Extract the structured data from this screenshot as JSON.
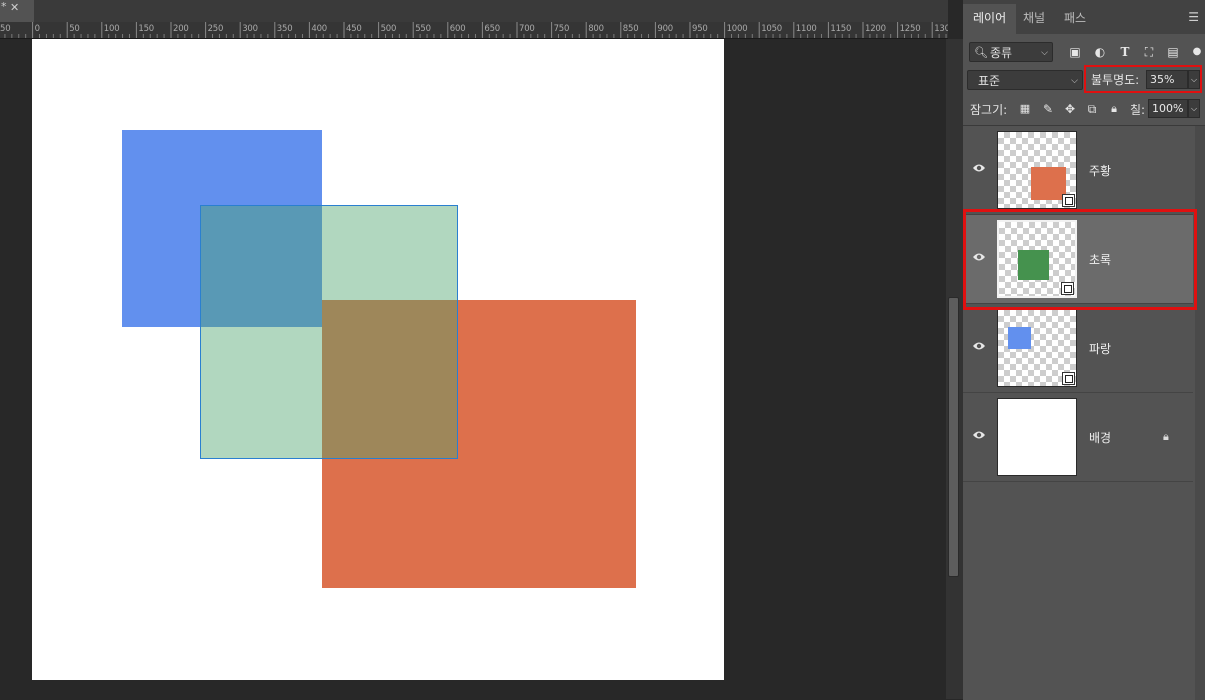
{
  "document": {
    "tab_marker": "*",
    "ruler_labels": [
      "50",
      "0",
      "50",
      "100",
      "150",
      "200",
      "250",
      "300",
      "350",
      "400",
      "450",
      "500",
      "550",
      "600",
      "650",
      "700",
      "750",
      "800",
      "850",
      "900",
      "950",
      "1000",
      "1050",
      "1100",
      "1150",
      "1200",
      "1250",
      "130"
    ]
  },
  "canvas": {
    "colors": {
      "blue": "#6290ee",
      "green": "#4ea56e",
      "orange": "#dd704c",
      "green_opacity_percent": 35
    }
  },
  "panel": {
    "tabs": [
      {
        "label": "레이어",
        "active": true
      },
      {
        "label": "채널",
        "active": false
      },
      {
        "label": "패스",
        "active": false
      }
    ],
    "filter": {
      "label": "종류",
      "icons": [
        "image-filter-icon",
        "adjustment-filter-icon",
        "type-filter-icon",
        "shape-filter-icon",
        "smart-object-filter-icon"
      ]
    },
    "blend_mode": "표준",
    "opacity": {
      "label": "불투명도:",
      "value": "35%"
    },
    "lock": {
      "label": "잠그기:",
      "icons": [
        "lock-transparent-pixels-icon",
        "lock-image-pixels-icon",
        "lock-position-icon",
        "lock-artboard-icon",
        "lock-all-icon"
      ]
    },
    "fill": {
      "label": "칠:",
      "value": "100%"
    },
    "layers": [
      {
        "name": "주황",
        "swatch": "#dd704c",
        "selected": false,
        "smart_object": true,
        "locked": false
      },
      {
        "name": "초록",
        "swatch": "#45924e",
        "selected": true,
        "smart_object": true,
        "locked": false
      },
      {
        "name": "파랑",
        "swatch": "#6290ee",
        "selected": false,
        "smart_object": true,
        "locked": false
      },
      {
        "name": "배경",
        "swatch": "#ffffff",
        "selected": false,
        "smart_object": false,
        "locked": true
      }
    ]
  }
}
